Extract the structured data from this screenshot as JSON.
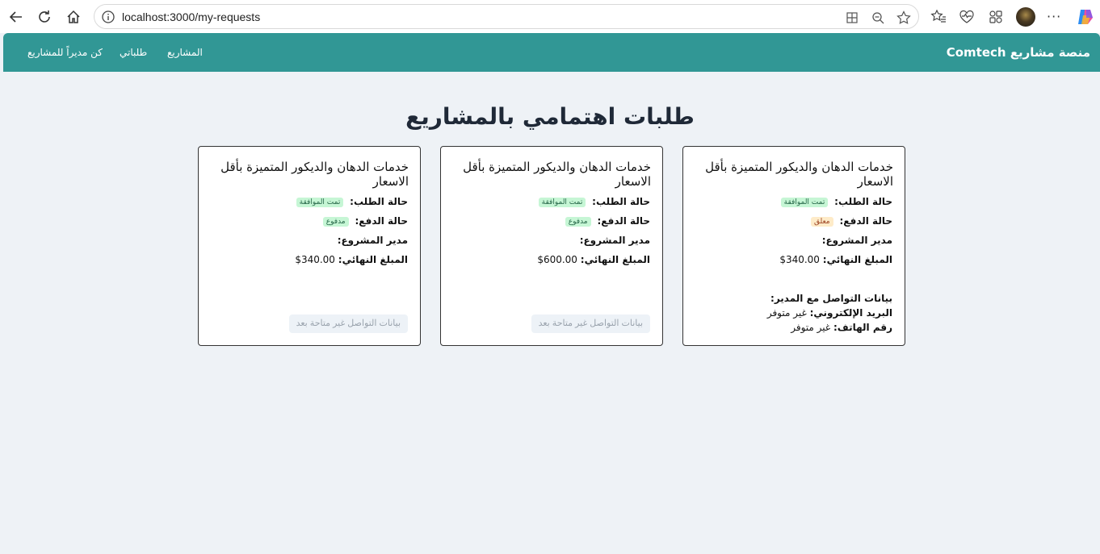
{
  "browser": {
    "url": "localhost:3000/my-requests"
  },
  "navbar": {
    "brand": "منصة مشاريع Comtech",
    "links": [
      {
        "label": "المشاريع"
      },
      {
        "label": "طلباتي"
      },
      {
        "label": "كن مديراً للمشاريع"
      }
    ]
  },
  "page": {
    "title": "طلبات اهتمامي بالمشاريع"
  },
  "cards": [
    {
      "title": "خدمات الدهان والديكور المتميزة بأقل الاسعار",
      "status_label": "حالة الطلب:",
      "status_value": "تمت الموافقة",
      "payment_label": "حالة الدفع:",
      "payment_value": "معلق",
      "manager_label": "مدير المشروع:",
      "amount_label": "المبلغ النهائي:",
      "amount_value": "$340.00",
      "contact_heading": "بيانات التواصل مع المدير:",
      "email_label": "البريد الإلكتروني:",
      "email_value": "غير متوفر",
      "phone_label": "رقم الهاتف:",
      "phone_value": "غير متوفر"
    },
    {
      "title": "خدمات الدهان والديكور المتميزة بأقل الاسعار",
      "status_label": "حالة الطلب:",
      "status_value": "تمت الموافقة",
      "payment_label": "حالة الدفع:",
      "payment_value": "مدفوع",
      "manager_label": "مدير المشروع:",
      "amount_label": "المبلغ النهائي:",
      "amount_value": "$600.00",
      "contact_button": "بيانات التواصل غير متاحة بعد"
    },
    {
      "title": "خدمات الدهان والديكور المتميزة بأقل الاسعار",
      "status_label": "حالة الطلب:",
      "status_value": "تمت الموافقة",
      "payment_label": "حالة الدفع:",
      "payment_value": "مدفوع",
      "manager_label": "مدير المشروع:",
      "amount_label": "المبلغ النهائي:",
      "amount_value": "$340.00",
      "contact_button": "بيانات التواصل غير متاحة بعد"
    }
  ],
  "colors": {
    "nav": "#319795",
    "background": "#eef2f6",
    "badge_green": "#c6f6d5",
    "badge_orange": "#feebc8"
  }
}
